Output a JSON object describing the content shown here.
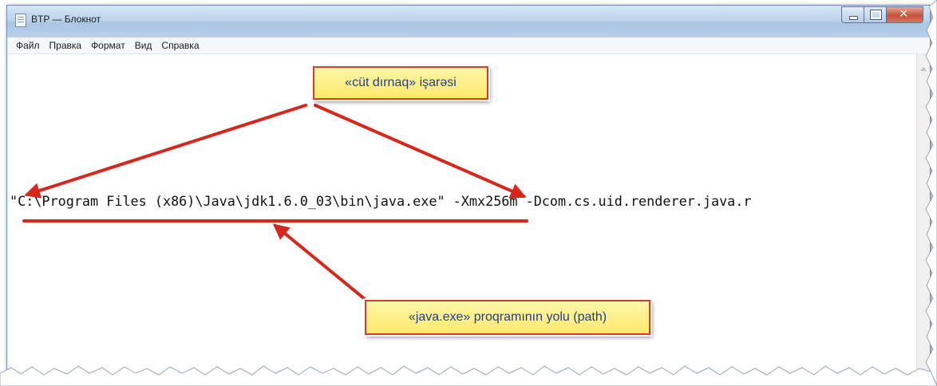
{
  "window": {
    "title": "BTP — Блокнот",
    "controls": {
      "minimize_icon": "minimize-icon",
      "maximize_icon": "maximize-icon",
      "close_icon": "close-icon",
      "close_glyph": "✕"
    }
  },
  "menu": {
    "items": [
      {
        "label": "Файл"
      },
      {
        "label": "Правка"
      },
      {
        "label": "Формат"
      },
      {
        "label": "Вид"
      },
      {
        "label": "Справка"
      }
    ]
  },
  "editor": {
    "line": "\"C:\\Program Files (x86)\\Java\\jdk1.6.0_03\\bin\\java.exe\" -Xmx256m -Dcom.cs.uid.renderer.java.r"
  },
  "annotations": {
    "top_callout": "«cüt dırnaq» işarəsi",
    "bottom_callout": "«java.exe» proqramının yolu (path)",
    "arrow_color": "#d8261c",
    "callout_border_color": "#d23e28",
    "callout_fill_color": "#ffef80",
    "callout_text_color": "#1d3f8f"
  },
  "colors": {
    "titlebar": "#bcd4ec",
    "close_button": "#c7503a",
    "menubar": "#f5f7fa"
  }
}
